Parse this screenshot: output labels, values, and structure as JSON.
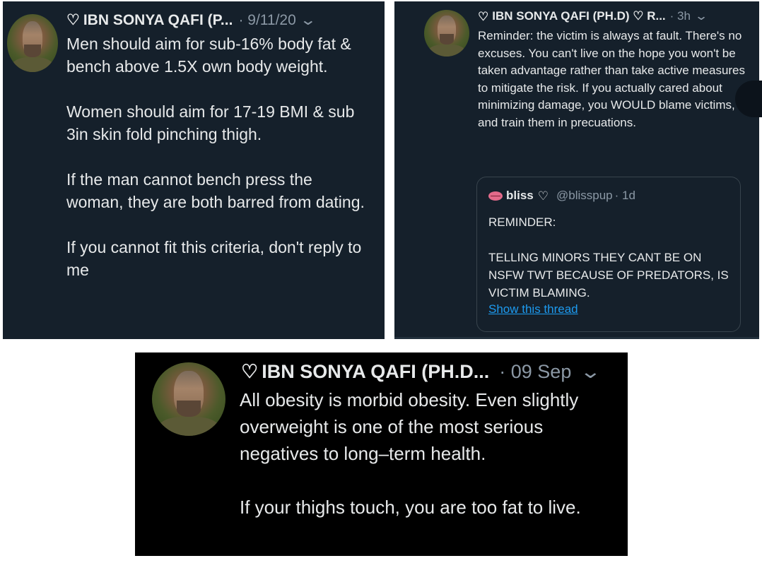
{
  "tweets": [
    {
      "name": "IBN SONYA QAFI (P...",
      "meta": "· 9/11/20",
      "text": "Men should aim for sub-16% body fat & bench above 1.5X own body weight.\n\nWomen should aim for 17-19 BMI & sub 3in skin fold pinching thigh.\n\nIf the man cannot bench press the woman, they are both barred from dating.\n\nIf you cannot fit this criteria, don't reply to me"
    },
    {
      "name": "IBN SONYA QAFI (PH.D) ♡ R...",
      "meta": "· 3h",
      "text": "Reminder: the victim is always at fault. There's no excuses. You can't live on the hope you won't be taken advantage rather than take active measures to mitigate the risk. If you actually cared about minimizing damage, you WOULD blame victims, and train them in precuations.",
      "quote": {
        "name": "bliss",
        "handle": "@blisspup",
        "meta": "· 1d",
        "text": "REMINDER:\n\nTELLING MINORS THEY CANT BE ON NSFW TWT BECAUSE OF PREDATORS, IS VICTIM BLAMING.",
        "link": "Show this thread"
      }
    },
    {
      "name": "IBN SONYA QAFI (PH.D...",
      "meta": "· 09 Sep",
      "text": "All obesity is morbid obesity. Even slightly overweight is one of the most serious negatives to long–term health.\n\nIf your thighs touch, you are too fat to live."
    }
  ],
  "icons": {
    "heart": "♡",
    "chevron": "⌄"
  },
  "colors": {
    "dim_background": "#15202b",
    "black_background": "#000000",
    "text": "#e7e9ea",
    "secondary_text": "#8b98a5",
    "link": "#1d9bf0"
  }
}
